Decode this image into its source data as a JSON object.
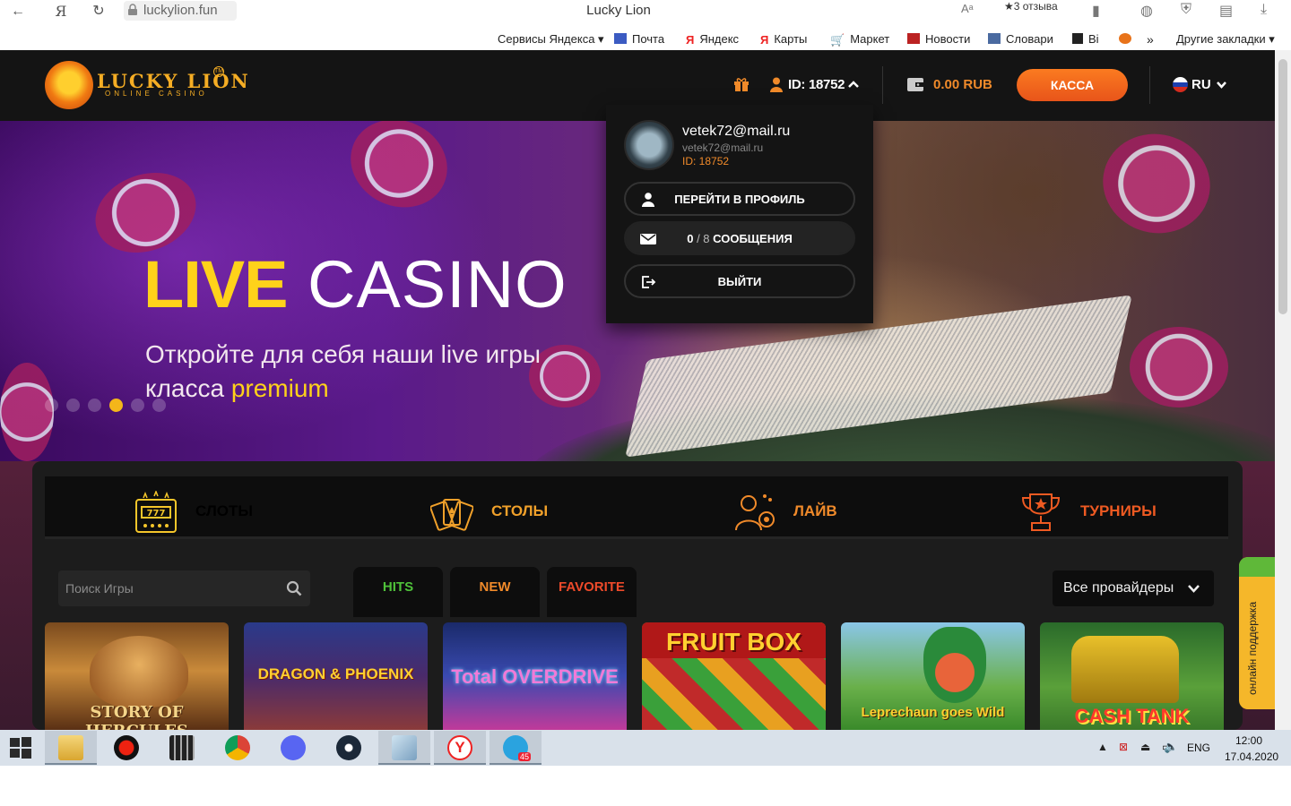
{
  "browser": {
    "url": "luckylion.fun",
    "title": "Lucky Lion",
    "reviews": "★3 отзыва",
    "bookmarks": [
      {
        "label": "Сервисы Яндекса ▾"
      },
      {
        "label": "Почта"
      },
      {
        "label": "Яндекс"
      },
      {
        "label": "Карты"
      },
      {
        "label": "Маркет"
      },
      {
        "label": "Новости"
      },
      {
        "label": "Словари"
      },
      {
        "label": "Вi"
      },
      {
        "label": "Другие закладки ▾"
      }
    ],
    "bookmarks_more": "»"
  },
  "site": {
    "logo_text": "LUCKY LION",
    "logo_sub": "ONLINE CASINO",
    "logo_tm": "TM",
    "user_id": "ID: 18752",
    "balance": "0.00 RUB",
    "kassa": "КАССА",
    "language": "RU"
  },
  "dropdown": {
    "email": "vetek72@mail.ru",
    "email_secondary": "vetek72@mail.ru",
    "id": "ID: 18752",
    "profile_button": "ПЕРЕЙТИ В ПРОФИЛЬ",
    "messages_count": "0",
    "messages_total": "/ 8",
    "messages_label": "СООБЩЕНИЯ",
    "logout_button": "ВЫЙТИ"
  },
  "hero": {
    "title_live": "LIVE",
    "title_casino": "CASINO",
    "subtitle_line1": "Откройте для себя наши live игры",
    "subtitle_line2": "класса",
    "subtitle_highlight": "premium",
    "active_slide": 4,
    "slide_count": 6
  },
  "categories": [
    {
      "label": "СЛОТЫ",
      "color": "#f5c62a"
    },
    {
      "label": "СТОЛЫ",
      "color": "#f0a02a"
    },
    {
      "label": "ЛАЙВ",
      "color": "#f08a2a"
    },
    {
      "label": "ТУРНИРЫ",
      "color": "#ee5a22"
    }
  ],
  "games_toolbar": {
    "search_placeholder": "Поиск Игры",
    "tabs": [
      {
        "label": "HITS",
        "color": "#4fc23a"
      },
      {
        "label": "NEW",
        "color": "#f08a2a"
      },
      {
        "label": "FAVORITE",
        "color": "#ee4a2a"
      }
    ],
    "provider": "Все провайдеры"
  },
  "games": [
    {
      "title": "STORY OF HERCULES"
    },
    {
      "title": "DRAGON & PHOENIX"
    },
    {
      "title": "Total OVERDRIVE"
    },
    {
      "title": "FRUIT BOX"
    },
    {
      "title": "Leprechaun goes Wild"
    },
    {
      "title": "CASH TANK"
    }
  ],
  "support": "онлайн поддержка",
  "taskbar": {
    "telegram_badge": "45",
    "lang": "ENG",
    "time": "12:00",
    "date": "17.04.2020"
  }
}
